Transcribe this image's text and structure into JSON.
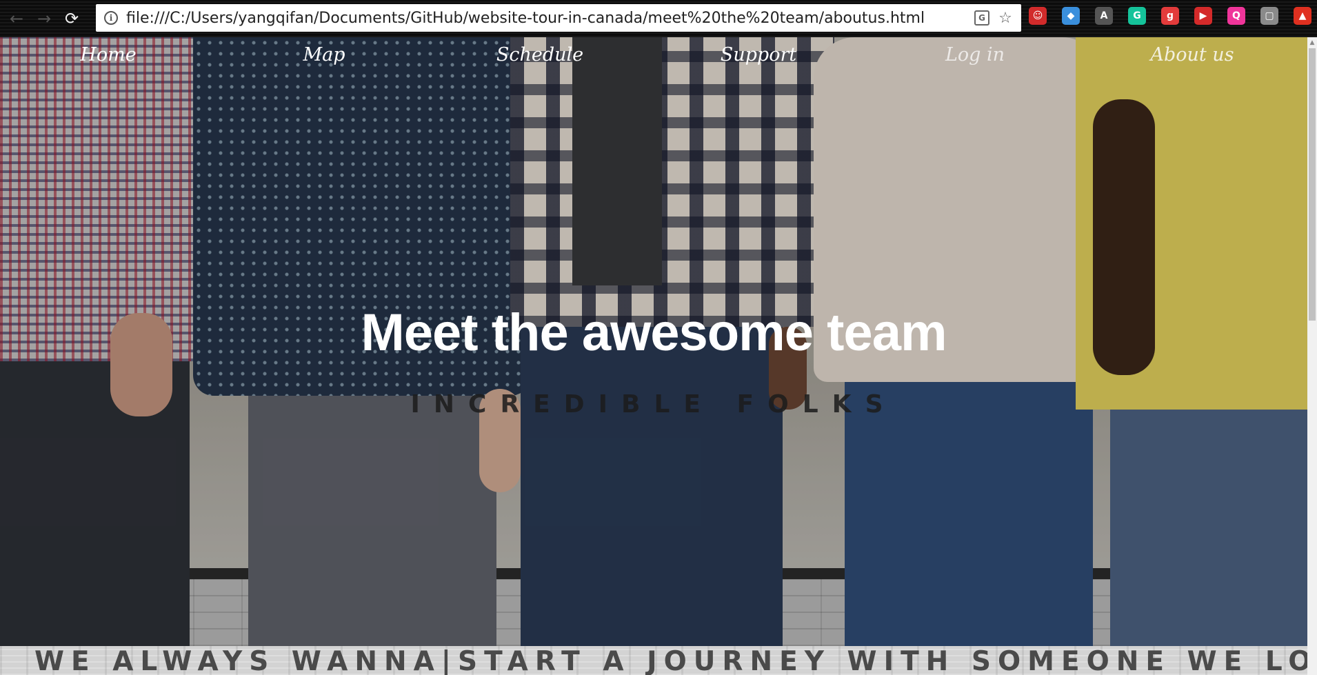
{
  "browser": {
    "url": "file:///C:/Users/yangqifan/Documents/GitHub/website-tour-in-canada/meet%20the%20team/aboutus.html",
    "back_icon": "←",
    "forward_icon": "→",
    "reload_icon": "⟳",
    "info_icon": "i",
    "translate_icon": "G",
    "bookmark_icon": "☆",
    "extensions": [
      {
        "name": "avatar-extension",
        "glyph": "☺",
        "color": "#d22b2b"
      },
      {
        "name": "chrome-apps-extension",
        "glyph": "◆",
        "color": "#3a8fdc"
      },
      {
        "name": "pdf-extension",
        "glyph": "A",
        "color": "#555555"
      },
      {
        "name": "grammarly-extension",
        "glyph": "G",
        "color": "#15c39a"
      },
      {
        "name": "red-square-extension",
        "glyph": "g",
        "color": "#e33b3b"
      },
      {
        "name": "forward-extension",
        "glyph": "▶",
        "color": "#d42a2a"
      },
      {
        "name": "pink-extension",
        "glyph": "Q",
        "color": "#f0359a"
      },
      {
        "name": "gray-extension",
        "glyph": "▢",
        "color": "#8a8a8a"
      },
      {
        "name": "upload-extension",
        "glyph": "▲",
        "color": "#e03020"
      }
    ]
  },
  "nav": {
    "home": "Home",
    "map": "Map",
    "schedule": "Schedule",
    "support": "Support",
    "login": "Log in",
    "about": "About us"
  },
  "hero": {
    "title": "Meet the awesome team",
    "subtitle": "INCREDIBLE FOLKS"
  },
  "tagline": "WE ALWAYS WANNA|START A JOURNEY WITH SOMEONE WE LOVE"
}
